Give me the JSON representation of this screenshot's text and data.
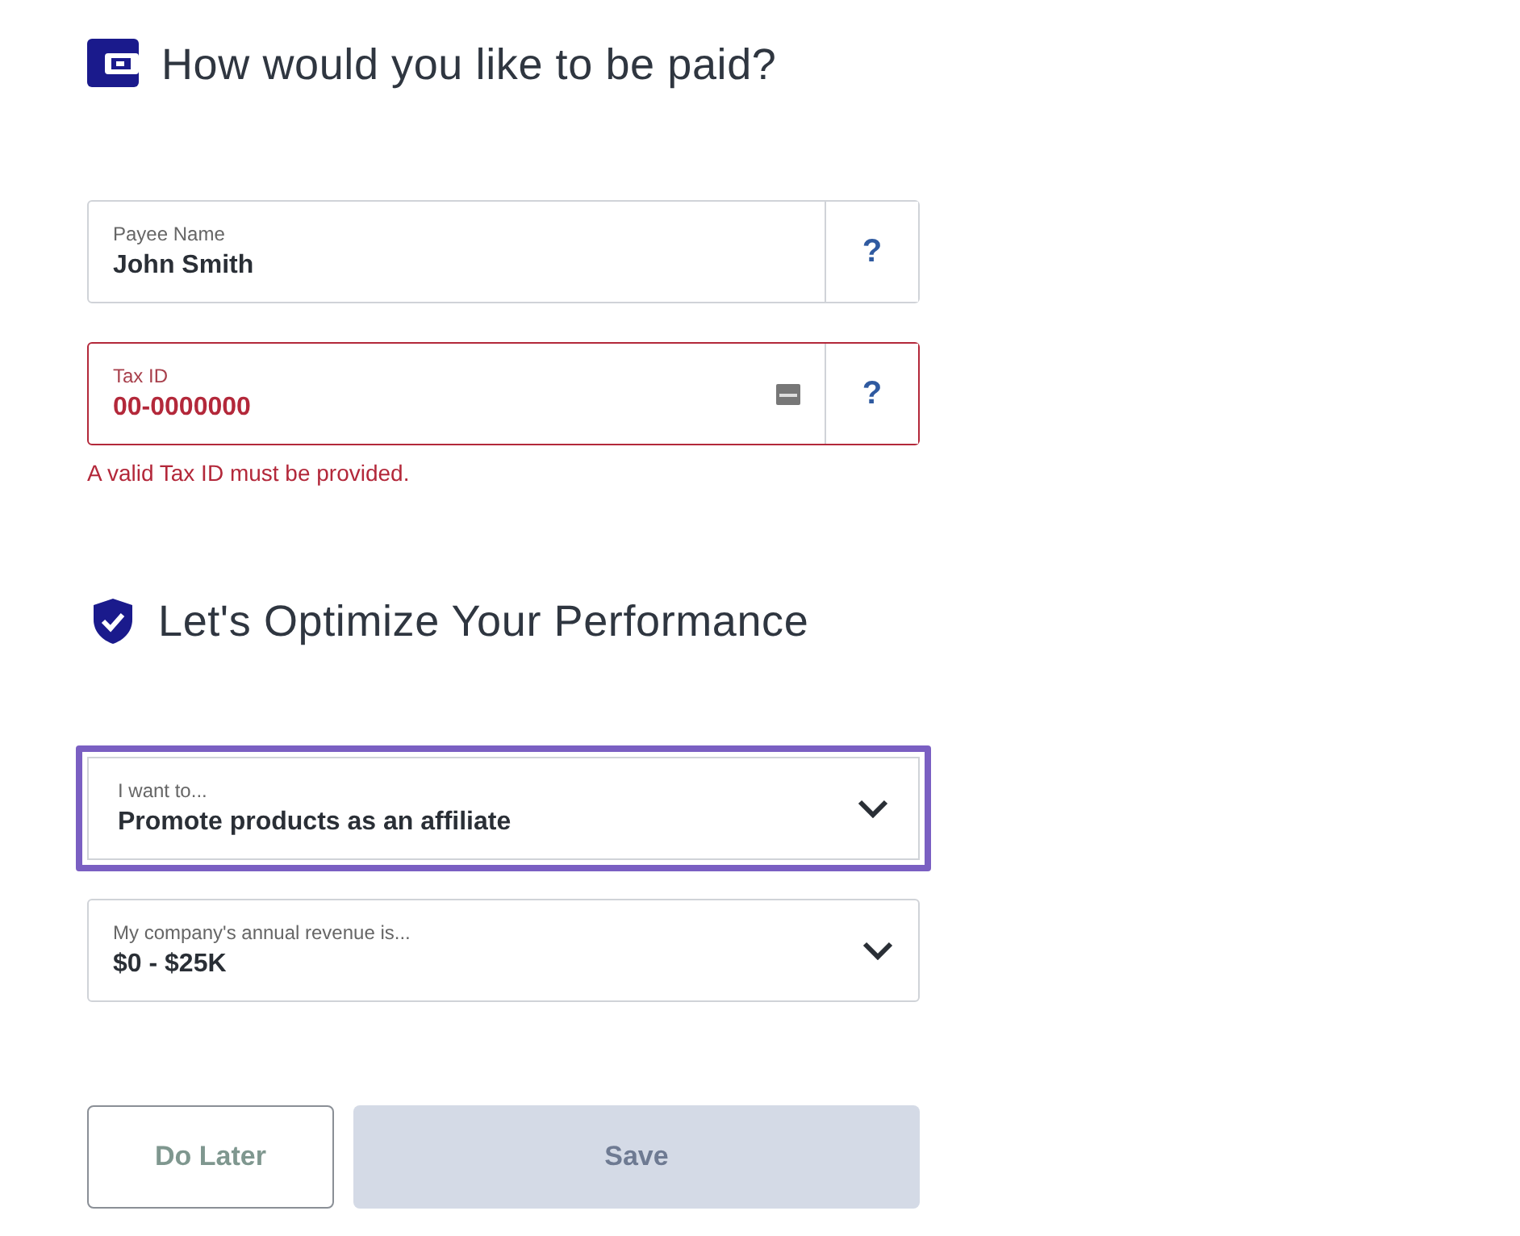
{
  "payment": {
    "title": "How would you like to be paid?",
    "fields": [
      {
        "label": "Payee Name",
        "value": "John Smith",
        "invalid": false,
        "help": "?"
      },
      {
        "label": "Tax ID",
        "value": "00-0000000",
        "invalid": true,
        "help": "?",
        "error": "A valid Tax ID must be provided."
      }
    ]
  },
  "performance": {
    "title": "Let's Optimize Your Performance",
    "selects": [
      {
        "label": "I want to...",
        "value": "Promote products as an affiliate",
        "focused": true
      },
      {
        "label": "My company's annual revenue is...",
        "value": "$0 - $25K",
        "focused": false
      }
    ]
  },
  "buttons": [
    {
      "label": "Do Later",
      "kind": "outline",
      "disabled": false
    },
    {
      "label": "Save",
      "kind": "primary",
      "disabled": true
    }
  ]
}
